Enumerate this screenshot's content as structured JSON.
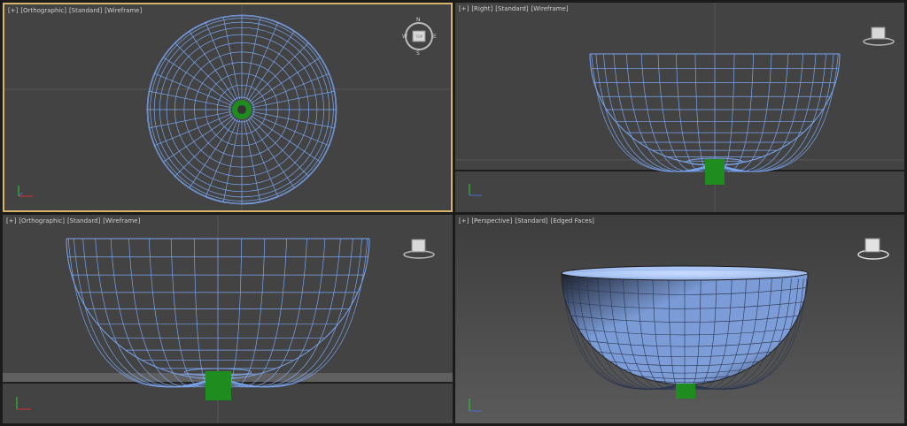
{
  "viewports": [
    {
      "id": "top",
      "menu": "[+]",
      "view": "[Orthographic]",
      "shading": "[Standard]",
      "mode": "[Wireframe]"
    },
    {
      "id": "right",
      "menu": "[+]",
      "view": "[Right]",
      "shading": "[Standard]",
      "mode": "[Wireframe]"
    },
    {
      "id": "front",
      "menu": "[+]",
      "view": "[Orthographic]",
      "shading": "[Standard]",
      "mode": "[Wireframe]"
    },
    {
      "id": "persp",
      "menu": "[+]",
      "view": "[Perspective]",
      "shading": "[Standard]",
      "mode": "[Edged Faces]"
    }
  ],
  "viewcube": {
    "n": "N",
    "s": "S",
    "e": "E",
    "w": "W",
    "face": "TOP"
  },
  "colors": {
    "wire": "#7aa6f0",
    "accent": "#d6b56a",
    "pivot": "#1f8c1f",
    "bg": "#434343"
  }
}
